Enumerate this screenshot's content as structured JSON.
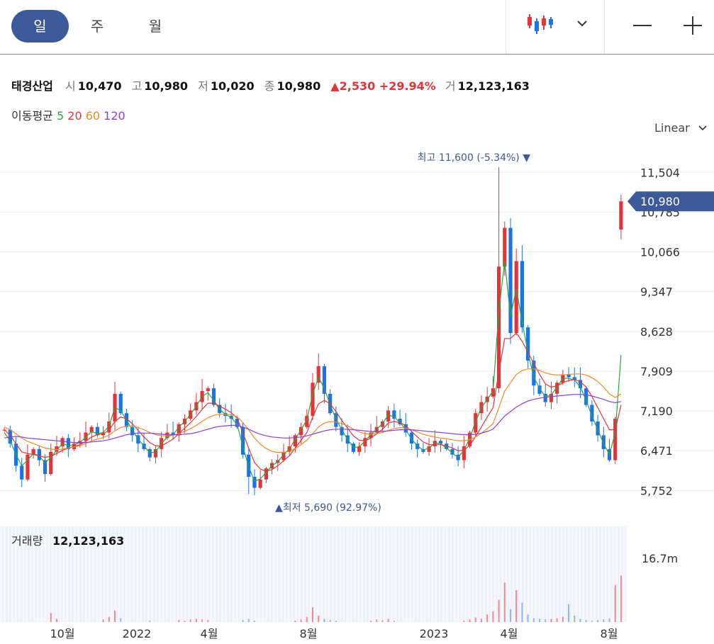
{
  "tabs": [
    "일",
    "주",
    "월"
  ],
  "active_tab": 0,
  "zoom_out_label": "—",
  "zoom_in_label": "+",
  "info": {
    "name": "태경산업",
    "open_label": "시",
    "open": "10,470",
    "high_label": "고",
    "high": "10,980",
    "low_label": "저",
    "low": "10,020",
    "close_label": "종",
    "close": "10,980",
    "change": "▲2,530 +29.94%",
    "volume_label": "거",
    "volume": "12,123,163"
  },
  "ma": {
    "label": "이동평균",
    "periods": [
      "5",
      "20",
      "60",
      "120"
    ],
    "colors": [
      "#2aa63a",
      "#e8323a",
      "#f08a24",
      "#8a3fe0"
    ]
  },
  "scale_mode": "Linear",
  "colors": {
    "up": "#e8323a",
    "down": "#1a73e8",
    "accent": "#3c5a9a"
  },
  "chart_data": {
    "type": "candlestick",
    "y_ticks": [
      5752,
      6471,
      7190,
      7909,
      8628,
      9347,
      10066,
      10785,
      11504
    ],
    "y_tick_labels": [
      "5,752",
      "6,471",
      "7,190",
      "7,909",
      "8,628",
      "9,347",
      "10,066",
      "10,785",
      "11,504"
    ],
    "ylim": [
      5500,
      11700
    ],
    "x_labels": [
      "10월",
      "2022",
      "4월",
      "8월",
      "2023",
      "4월",
      "8월"
    ],
    "last_price": 10980,
    "last_price_label": "10,980",
    "max_note": "최고 11,600 (-5.34%) ▼",
    "min_note": "▲최저 5,690 (92.97%)",
    "max_value": 11600,
    "min_value": 5690,
    "close_series": [
      6850,
      6600,
      6200,
      5950,
      6400,
      6500,
      6300,
      6050,
      6450,
      6550,
      6700,
      6500,
      6600,
      6650,
      6800,
      6900,
      6750,
      6800,
      7000,
      7500,
      7150,
      6900,
      6750,
      6600,
      6500,
      6350,
      6500,
      6700,
      6800,
      6750,
      6950,
      7050,
      7200,
      7350,
      7550,
      7600,
      7300,
      7150,
      7100,
      7050,
      6900,
      6400,
      6000,
      5800,
      5950,
      6150,
      6250,
      6300,
      6450,
      6550,
      6750,
      6900,
      7100,
      7700,
      8000,
      7500,
      7150,
      6900,
      6750,
      6600,
      6450,
      6550,
      6700,
      6800,
      6900,
      7000,
      7200,
      7050,
      6950,
      6800,
      6600,
      6500,
      6450,
      6550,
      6650,
      6600,
      6500,
      6400,
      6300,
      6550,
      6800,
      7150,
      7350,
      7450,
      7600,
      9800,
      10500,
      8600,
      9900,
      8700,
      8100,
      7650,
      7500,
      7350,
      7500,
      7700,
      7850,
      7800,
      7750,
      7600,
      7300,
      7000,
      6750,
      6500,
      6300,
      7050,
      10980
    ],
    "ma_series": [
      {
        "name": "5",
        "values": [
          6800,
          6650,
          6400,
          6200,
          6300,
          6420,
          6380,
          6250,
          6350,
          6480,
          6600,
          6560,
          6580,
          6620,
          6720,
          6820,
          6780,
          6800,
          6920,
          7250,
          7200,
          7020,
          6850,
          6680,
          6560,
          6430,
          6450,
          6600,
          6720,
          6760,
          6900,
          7000,
          7130,
          7280,
          7450,
          7520,
          7380,
          7220,
          7130,
          7070,
          6950,
          6550,
          6180,
          5920,
          5960,
          6080,
          6200,
          6270,
          6400,
          6500,
          6680,
          6850,
          7030,
          7500,
          7800,
          7600,
          7300,
          7050,
          6850,
          6680,
          6530,
          6540,
          6650,
          6760,
          6860,
          6960,
          7120,
          7080,
          6980,
          6850,
          6680,
          6560,
          6480,
          6520,
          6610,
          6600,
          6520,
          6430,
          6350,
          6480,
          6700,
          7000,
          7250,
          7400,
          7550,
          9000,
          9900,
          8900,
          9400,
          8800,
          8250,
          7800,
          7600,
          7450,
          7480,
          7620,
          7780,
          7780,
          7750,
          7620,
          7380,
          7100,
          6850,
          6600,
          6400,
          6800,
          8200
        ]
      },
      {
        "name": "20",
        "values": [
          6850,
          6750,
          6600,
          6450,
          6420,
          6400,
          6380,
          6350,
          6370,
          6420,
          6480,
          6520,
          6550,
          6580,
          6640,
          6720,
          6760,
          6780,
          6840,
          7000,
          7080,
          7050,
          6960,
          6840,
          6720,
          6620,
          6560,
          6560,
          6620,
          6680,
          6780,
          6880,
          6980,
          7090,
          7220,
          7330,
          7330,
          7280,
          7220,
          7160,
          7060,
          6800,
          6520,
          6260,
          6140,
          6100,
          6130,
          6200,
          6290,
          6380,
          6520,
          6660,
          6800,
          7080,
          7320,
          7380,
          7320,
          7180,
          7020,
          6880,
          6740,
          6660,
          6650,
          6700,
          6780,
          6860,
          6970,
          7000,
          6980,
          6920,
          6820,
          6720,
          6630,
          6580,
          6580,
          6580,
          6560,
          6520,
          6470,
          6480,
          6570,
          6730,
          6900,
          7080,
          7250,
          7900,
          8500,
          8500,
          8600,
          8450,
          8250,
          8050,
          7850,
          7680,
          7620,
          7640,
          7700,
          7740,
          7760,
          7720,
          7620,
          7450,
          7250,
          7050,
          6850,
          6850,
          7300
        ]
      },
      {
        "name": "60",
        "values": [
          6900,
          6850,
          6780,
          6700,
          6640,
          6600,
          6560,
          6520,
          6500,
          6490,
          6500,
          6520,
          6540,
          6560,
          6600,
          6650,
          6680,
          6710,
          6750,
          6830,
          6890,
          6920,
          6920,
          6890,
          6850,
          6800,
          6760,
          6740,
          6740,
          6750,
          6780,
          6820,
          6870,
          6930,
          7000,
          7070,
          7110,
          7130,
          7130,
          7120,
          7090,
          6980,
          6850,
          6700,
          6590,
          6510,
          6460,
          6440,
          6440,
          6460,
          6510,
          6580,
          6660,
          6780,
          6900,
          6970,
          7000,
          6990,
          6960,
          6920,
          6860,
          6810,
          6780,
          6770,
          6780,
          6800,
          6840,
          6870,
          6890,
          6880,
          6850,
          6810,
          6770,
          6740,
          6720,
          6700,
          6690,
          6670,
          6650,
          6650,
          6670,
          6720,
          6790,
          6870,
          6960,
          7250,
          7550,
          7700,
          7850,
          7920,
          7950,
          7950,
          7920,
          7880,
          7850,
          7840,
          7840,
          7850,
          7860,
          7860,
          7840,
          7790,
          7720,
          7620,
          7500,
          7430,
          7500
        ]
      },
      {
        "name": "120",
        "values": [
          6700,
          6720,
          6730,
          6720,
          6700,
          6690,
          6680,
          6670,
          6660,
          6650,
          6640,
          6630,
          6620,
          6620,
          6620,
          6630,
          6640,
          6650,
          6670,
          6700,
          6730,
          6760,
          6780,
          6790,
          6790,
          6790,
          6780,
          6770,
          6760,
          6760,
          6760,
          6770,
          6780,
          6800,
          6830,
          6860,
          6890,
          6910,
          6920,
          6930,
          6930,
          6900,
          6860,
          6810,
          6770,
          6740,
          6720,
          6710,
          6700,
          6700,
          6710,
          6720,
          6740,
          6770,
          6800,
          6830,
          6850,
          6860,
          6860,
          6860,
          6850,
          6840,
          6830,
          6820,
          6820,
          6820,
          6830,
          6840,
          6850,
          6850,
          6850,
          6840,
          6830,
          6820,
          6810,
          6800,
          6790,
          6780,
          6770,
          6760,
          6760,
          6770,
          6790,
          6820,
          6860,
          6980,
          7100,
          7180,
          7260,
          7320,
          7370,
          7400,
          7420,
          7440,
          7450,
          7460,
          7470,
          7480,
          7490,
          7490,
          7480,
          7460,
          7430,
          7400,
          7360,
          7340,
          7360
        ]
      }
    ],
    "volume": {
      "label": "거래량",
      "value": "12,123,163",
      "max_label": "16.7m",
      "max": 16700000,
      "spikes": [
        0,
        0,
        0,
        0,
        0,
        0,
        0,
        0,
        0.14,
        0.05,
        0,
        0,
        0,
        0,
        0,
        0,
        0,
        0.04,
        0.08,
        0.18,
        0.06,
        0,
        0,
        0,
        0,
        0.02,
        0,
        0,
        0,
        0,
        0.03,
        0.02,
        0.04,
        0.05,
        0.04,
        0.03,
        0,
        0,
        0,
        0,
        0,
        0.03,
        0.05,
        0.02,
        0,
        0,
        0,
        0,
        0,
        0,
        0.02,
        0.04,
        0.08,
        0.23,
        0.1,
        0.05,
        0.03,
        0.02,
        0,
        0,
        0,
        0,
        0,
        0.02,
        0.04,
        0.03,
        0.05,
        0.02,
        0,
        0,
        0,
        0,
        0,
        0,
        0,
        0,
        0,
        0,
        0,
        0.02,
        0.04,
        0.07,
        0.05,
        0.12,
        0.17,
        0.35,
        0.62,
        0.2,
        0.5,
        0.3,
        0.12,
        0.06,
        0.05,
        0.04,
        0.05,
        0.06,
        0.08,
        0.28,
        0.1,
        0.05,
        0.03,
        0.02,
        0.03,
        0.04,
        0.06,
        0.58,
        0.73
      ]
    }
  }
}
